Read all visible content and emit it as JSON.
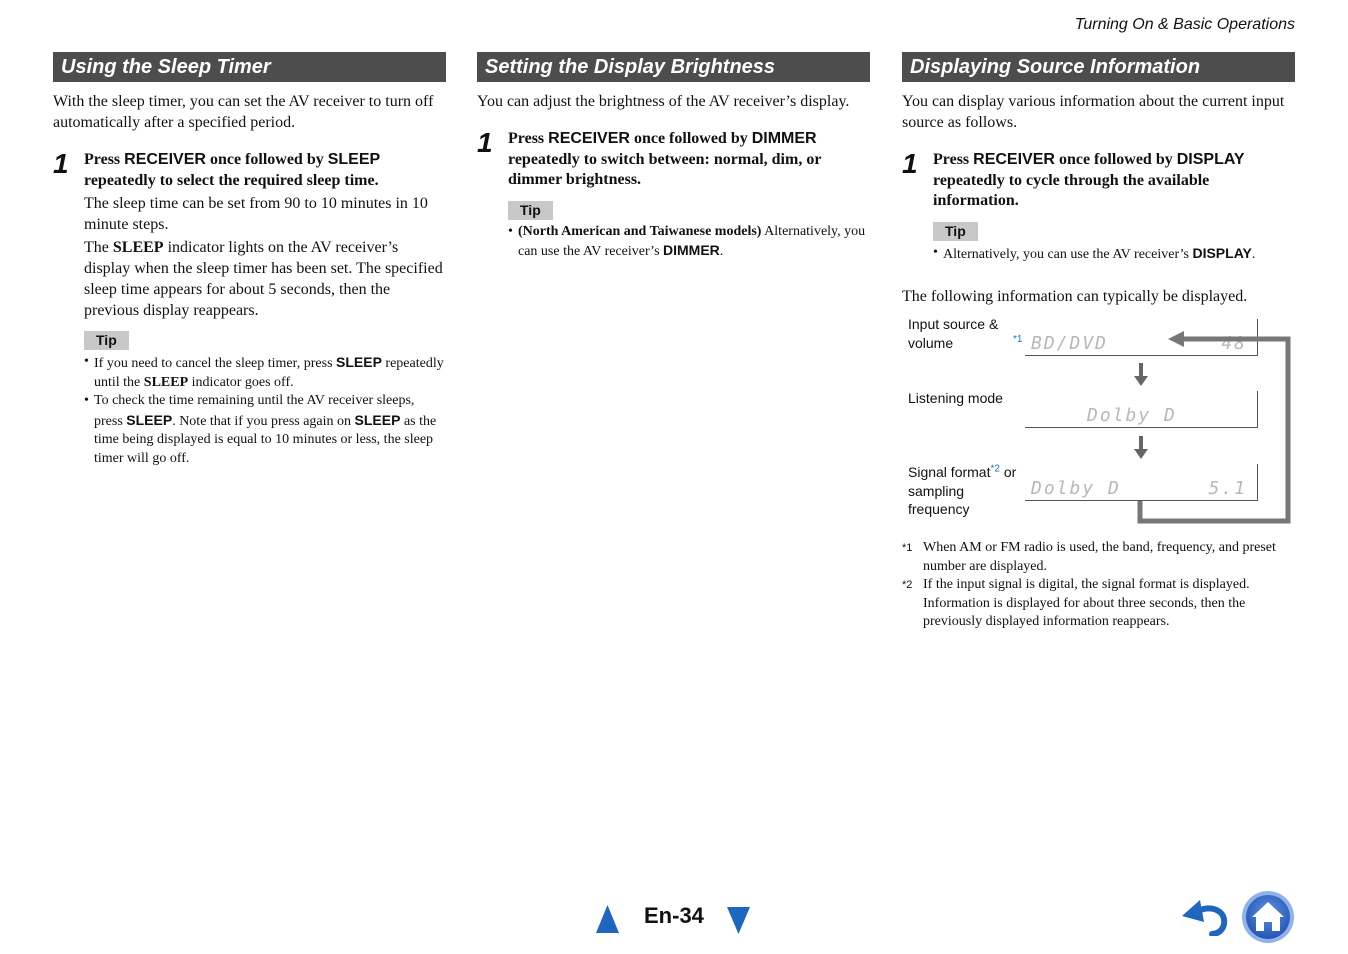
{
  "header": {
    "running_title": "Turning On & Basic Operations"
  },
  "sections": [
    {
      "title": "Using the Sleep Timer",
      "intro": "With the sleep timer, you can set the AV receiver to turn off automatically after a specified period.",
      "step": {
        "number": "1",
        "title_parts": [
          "Press ",
          "RECEIVER",
          " once followed by ",
          "SLEEP",
          " repeatedly to select the required sleep time."
        ],
        "body": [
          "The sleep time can be set from 90 to 10 minutes in 10 minute steps.",
          [
            "The ",
            "SLEEP",
            " indicator lights on the AV receiver’s display when the sleep timer has been set. The specified sleep time appears for about 5 seconds, then the previous display reappears."
          ]
        ]
      },
      "tip_label": "Tip",
      "tips": [
        [
          "If you need to cancel the sleep timer, press ",
          "SLEEP",
          " repeatedly until the ",
          "SLEEP",
          " indicator goes off."
        ],
        [
          "To check the time remaining until the AV receiver sleeps, press ",
          "SLEEP",
          ". Note that if you press again on ",
          "SLEEP",
          " as the time being displayed is equal to 10 minutes or less, the sleep timer will go off."
        ]
      ]
    },
    {
      "title": "Setting the Display Brightness",
      "intro": "You can adjust the brightness of the AV receiver’s display.",
      "step": {
        "number": "1",
        "title_parts": [
          "Press ",
          "RECEIVER",
          " once followed by ",
          "DIMMER",
          " repeatedly to switch between: normal, dim, or dimmer brightness."
        ]
      },
      "tip_label": "Tip",
      "tips": [
        [
          "(North American and Taiwanese models)",
          " Alternatively, you can use the AV receiver’s ",
          "DIMMER",
          "."
        ]
      ]
    },
    {
      "title": "Displaying Source Information",
      "intro": "You can display various information about the current input source as follows.",
      "step": {
        "number": "1",
        "title_parts": [
          "Press ",
          "RECEIVER",
          " once followed by ",
          "DISPLAY",
          " repeatedly to cycle through the available information."
        ]
      },
      "tip_label": "Tip",
      "tips": [
        [
          "Alternatively, you can use the AV receiver’s ",
          "DISPLAY",
          "."
        ]
      ],
      "following": "The following information can typically be displayed.",
      "diagram": {
        "rows": [
          {
            "label": "Input source & volume",
            "sup": "*1",
            "lcd_left": "BD/DVD",
            "lcd_right": "48"
          },
          {
            "label": "Listening mode",
            "sup": "",
            "lcd_left": "Dolby D",
            "lcd_right": ""
          },
          {
            "label": "Signal format",
            "label_rest": "or sampling frequency",
            "sup": "*2",
            "lcd_left": "Dolby D",
            "lcd_right": "5.1"
          }
        ]
      },
      "footnotes": [
        {
          "mark": "*1",
          "text": "When AM or FM radio is used, the band, frequency, and preset number are displayed."
        },
        {
          "mark": "*2",
          "text": "If the input signal is digital, the signal format is displayed. Information is displayed for about three seconds, then the previously displayed information reappears."
        }
      ]
    }
  ],
  "footer": {
    "page_label": "En-34",
    "prev_page": "previous-page",
    "next_page": "next-page",
    "back": "back",
    "home": "home"
  },
  "colors": {
    "accent_blue": "#1f66c1",
    "section_header_bg": "#4d4d4d",
    "tip_bg": "#c8c8c8",
    "footnote_sup": "#1a6fd6"
  }
}
